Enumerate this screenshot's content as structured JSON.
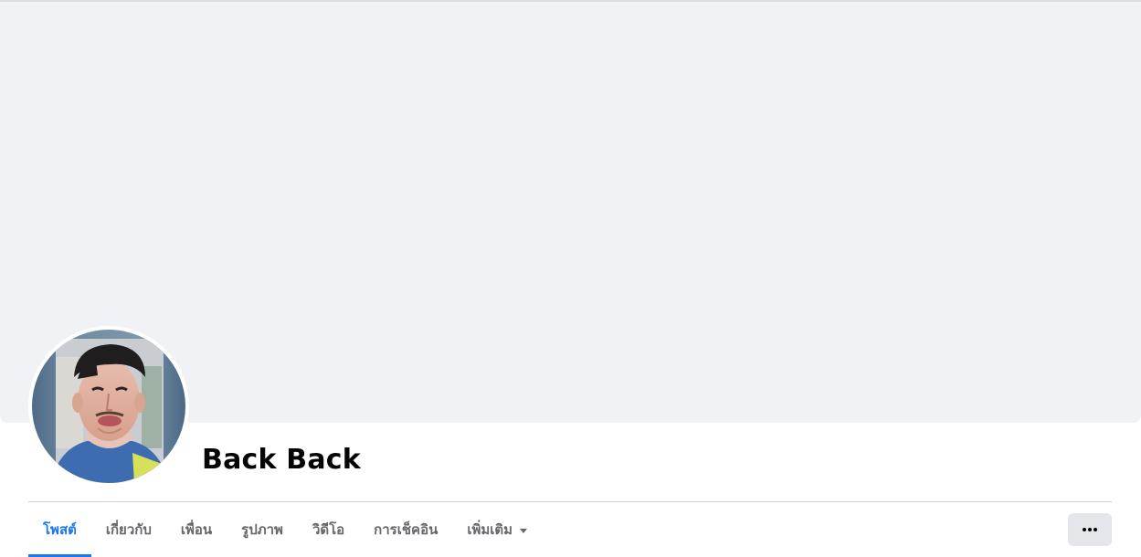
{
  "profile": {
    "name": "Back Back",
    "avatar_icon": "profile-photo"
  },
  "tabs": [
    {
      "label": "โพสต์",
      "active": true
    },
    {
      "label": "เกี่ยวกับ",
      "active": false
    },
    {
      "label": "เพื่อน",
      "active": false
    },
    {
      "label": "รูปภาพ",
      "active": false
    },
    {
      "label": "วิดีโอ",
      "active": false
    },
    {
      "label": "การเช็คอิน",
      "active": false
    },
    {
      "label": "เพิ่มเติม",
      "active": false,
      "dropdown": true
    }
  ],
  "actions": {
    "more_icon": "ellipsis-icon"
  },
  "colors": {
    "accent": "#1877f2",
    "cover": "#f0f2f5",
    "tab_text": "#65676b",
    "button_bg": "#e4e6eb"
  }
}
